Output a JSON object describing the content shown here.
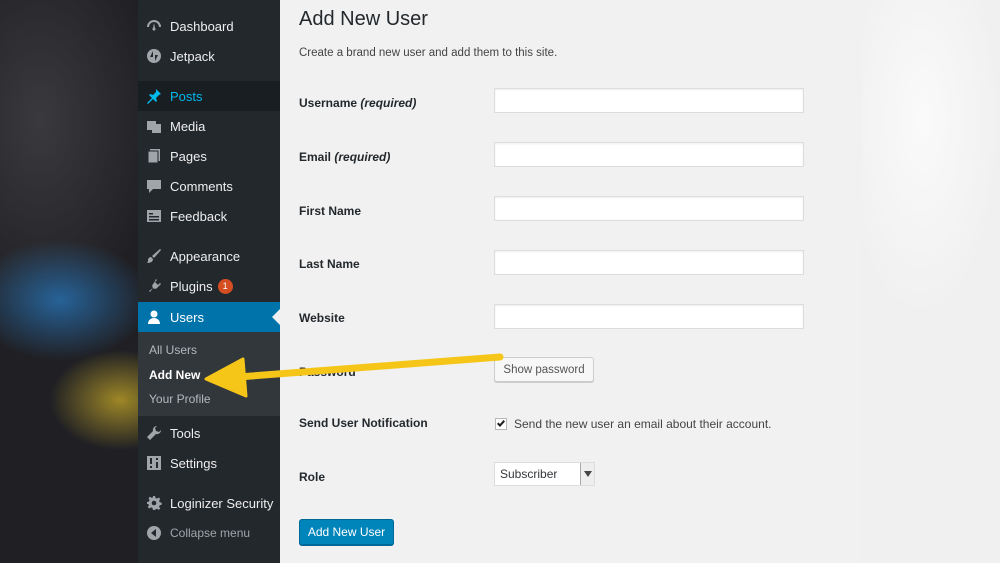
{
  "sidebar": {
    "items": [
      {
        "label": "Dashboard",
        "icon": "dashboard-icon"
      },
      {
        "label": "Jetpack",
        "icon": "jetpack-icon"
      },
      {
        "label": "Posts",
        "icon": "pushpin-icon"
      },
      {
        "label": "Media",
        "icon": "media-icon"
      },
      {
        "label": "Pages",
        "icon": "pages-icon"
      },
      {
        "label": "Comments",
        "icon": "comment-icon"
      },
      {
        "label": "Feedback",
        "icon": "feedback-icon"
      },
      {
        "label": "Appearance",
        "icon": "paintbrush-icon"
      },
      {
        "label": "Plugins",
        "icon": "plugin-icon",
        "badge": "1"
      },
      {
        "label": "Users",
        "icon": "user-icon"
      },
      {
        "label": "Tools",
        "icon": "wrench-icon"
      },
      {
        "label": "Settings",
        "icon": "settings-icon"
      },
      {
        "label": "Loginizer Security",
        "icon": "gear-icon"
      },
      {
        "label": "Collapse menu",
        "icon": "collapse-icon"
      }
    ],
    "users_submenu": [
      "All Users",
      "Add New",
      "Your Profile"
    ]
  },
  "main": {
    "title": "Add New User",
    "intro": "Create a brand new user and add them to this site.",
    "fields": {
      "username": {
        "label": "Username",
        "hint": "(required)",
        "value": ""
      },
      "email": {
        "label": "Email",
        "hint": "(required)",
        "value": ""
      },
      "first_name": {
        "label": "First Name",
        "value": ""
      },
      "last_name": {
        "label": "Last Name",
        "value": ""
      },
      "website": {
        "label": "Website",
        "value": ""
      },
      "password": {
        "label": "Password",
        "button": "Show password"
      },
      "notification": {
        "label": "Send User Notification",
        "checked": true,
        "text": "Send the new user an email about their account."
      },
      "role": {
        "label": "Role",
        "selected": "Subscriber"
      }
    },
    "submit_label": "Add New User"
  },
  "colors": {
    "sidebar_bg": "#23282d",
    "submenu_bg": "#32373c",
    "accent_blue": "#0073aa",
    "primary_button": "#0085ba",
    "posts_highlight": "#00b9eb",
    "badge": "#d54e21",
    "annotation_arrow": "#f5c518"
  }
}
